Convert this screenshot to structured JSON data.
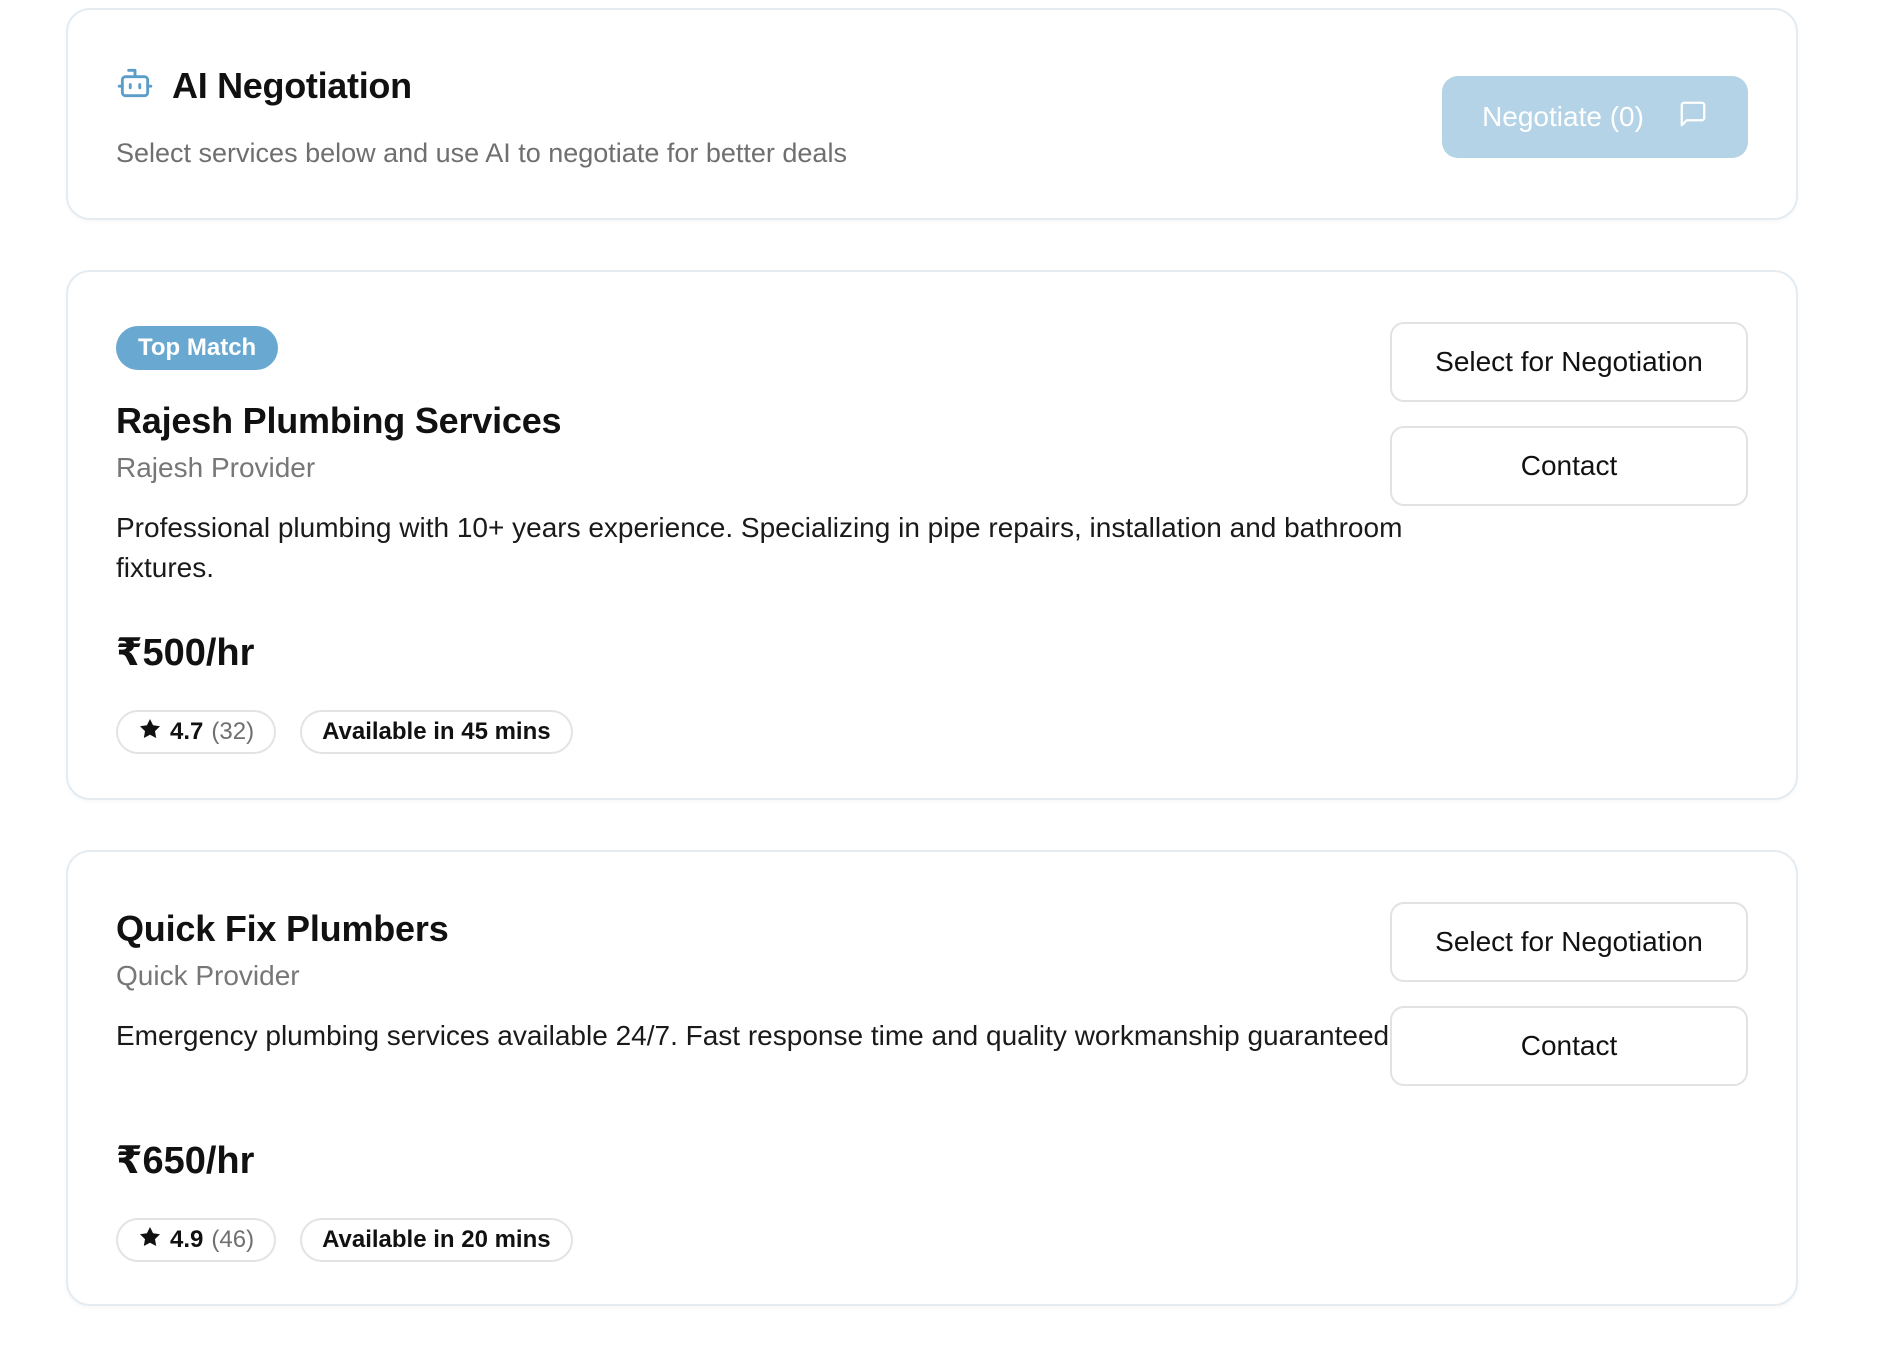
{
  "negotiation": {
    "title": "AI Negotiation",
    "subtitle": "Select services below and use AI to negotiate for better deals",
    "button_label": "Negotiate (0)",
    "icon": "robot-icon",
    "button_icon": "message-square-icon",
    "button_color": "#b4d3e6"
  },
  "providers": [
    {
      "badge": "Top Match",
      "name": "Rajesh Plumbing Services",
      "owner": "Rajesh Provider",
      "description": "Professional plumbing with 10+ years experience. Specializing in pipe repairs, installation and bathroom fixtures.",
      "price": "₹500/hr",
      "rating": "4.7",
      "reviews": "(32)",
      "availability": "Available in 45 mins",
      "select_label": "Select for Negotiation",
      "contact_label": "Contact"
    },
    {
      "name": "Quick Fix Plumbers",
      "owner": "Quick Provider",
      "description": "Emergency plumbing services available 24/7. Fast response time and quality workmanship guaranteed.",
      "price": "₹650/hr",
      "rating": "4.9",
      "reviews": "(46)",
      "availability": "Available in 20 mins",
      "select_label": "Select for Negotiation",
      "contact_label": "Contact"
    }
  ],
  "colors": {
    "badge_bg": "#69a8d0",
    "accent": "#5b9cc9",
    "card_border": "#e4ecf2"
  }
}
